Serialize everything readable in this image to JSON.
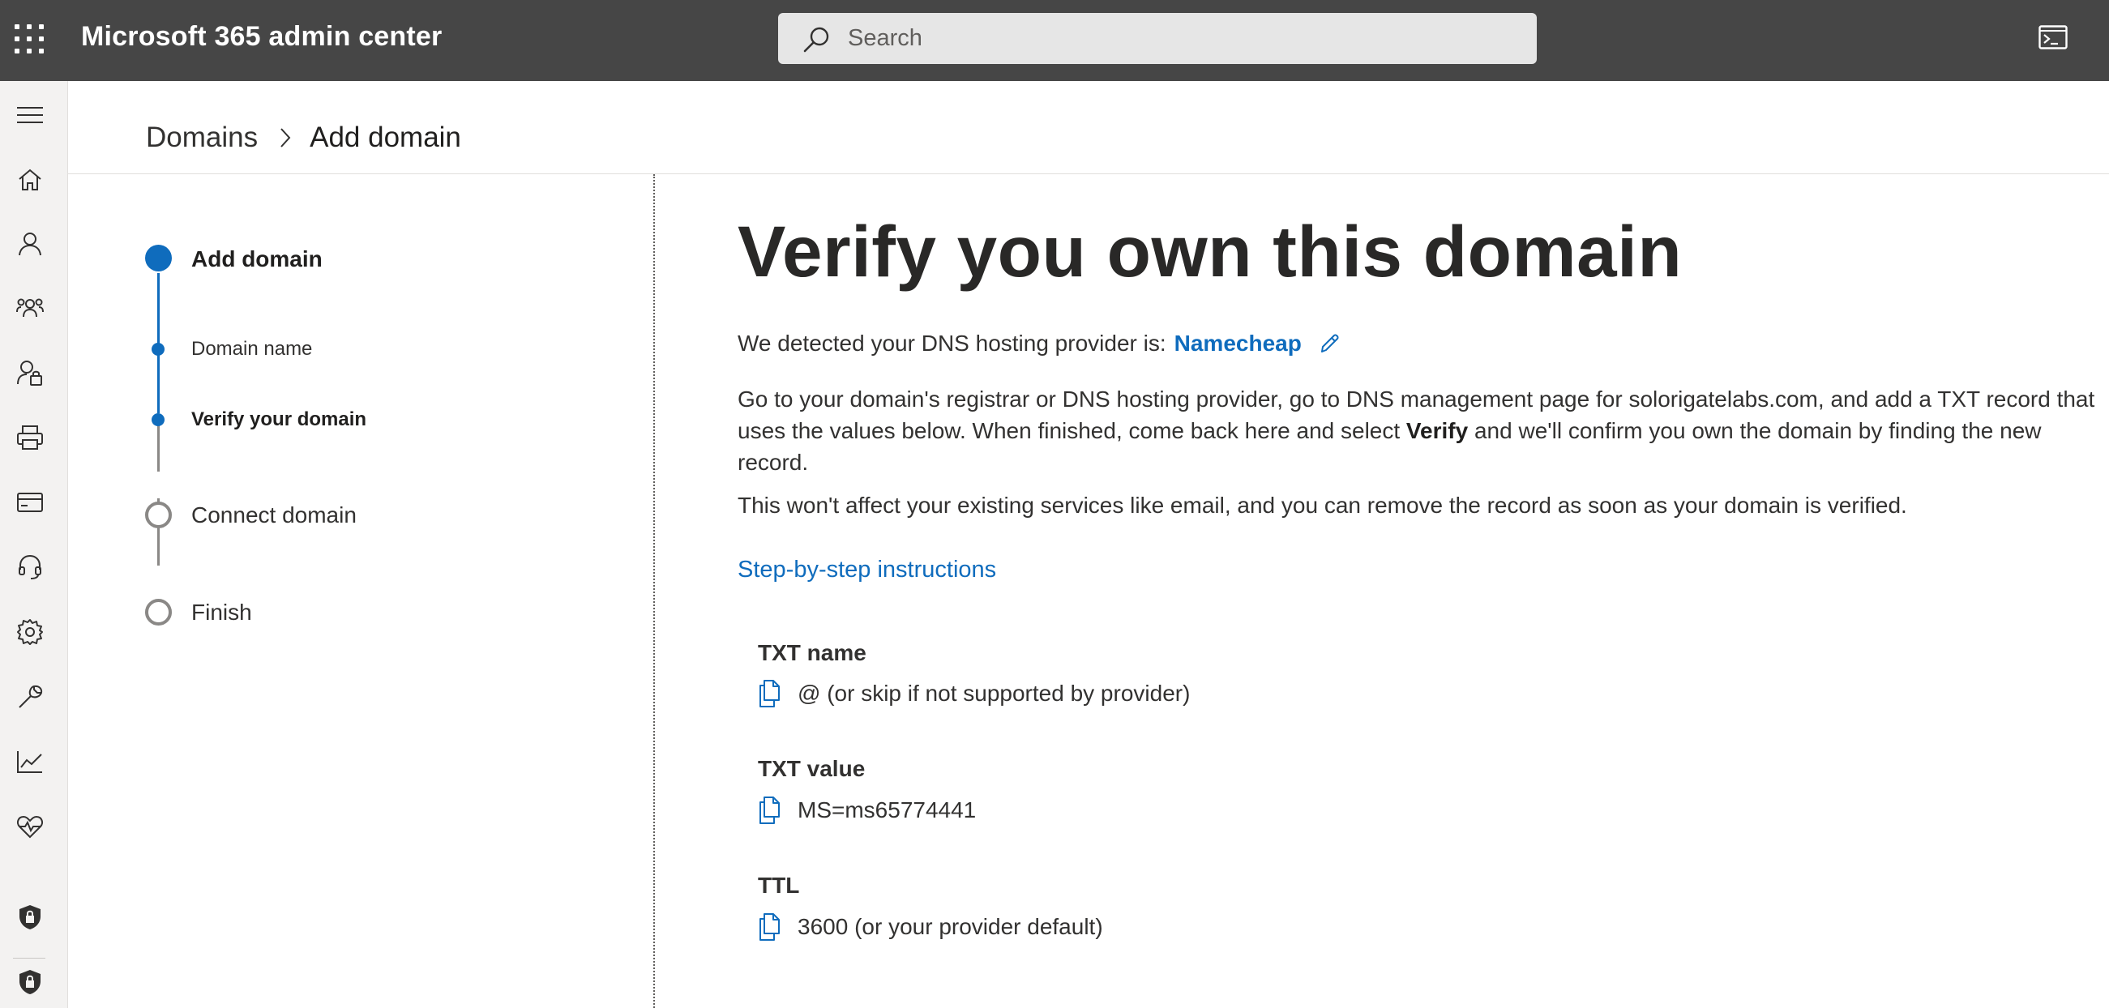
{
  "app": {
    "title": "Microsoft 365 admin center",
    "waffle_icon": "app-launcher-icon",
    "console_icon": "cloud-shell-icon"
  },
  "search": {
    "placeholder": "Search",
    "value": ""
  },
  "rail": {
    "items": [
      {
        "icon": "hamburger-menu-icon"
      },
      {
        "icon": "home-icon"
      },
      {
        "icon": "user-icon"
      },
      {
        "icon": "teams-icon"
      },
      {
        "icon": "roles-icon"
      },
      {
        "icon": "printer-icon"
      },
      {
        "icon": "billing-icon"
      },
      {
        "icon": "support-icon"
      },
      {
        "icon": "settings-icon"
      },
      {
        "icon": "setup-icon"
      },
      {
        "icon": "reports-icon"
      },
      {
        "icon": "health-icon"
      },
      {
        "icon": "security-icon"
      },
      {
        "icon": "compliance-icon"
      }
    ]
  },
  "breadcrumb": {
    "parent": "Domains",
    "current": "Add domain"
  },
  "stepper": {
    "steps": [
      {
        "label": "Add domain",
        "state": "active"
      },
      {
        "label": "Domain name",
        "state": "done-substep"
      },
      {
        "label": "Verify your domain",
        "state": "current-substep"
      },
      {
        "label": "Connect domain",
        "state": "pending"
      },
      {
        "label": "Finish",
        "state": "pending"
      }
    ],
    "active_color": "#0f6cbd"
  },
  "content": {
    "heading": "Verify you own this domain",
    "detected_prefix": "We detected your DNS hosting provider is:",
    "provider": "Namecheap",
    "instructions_a": "Go to your domain's registrar or DNS hosting provider, go to DNS management page for solorigatelabs.com, and add a TXT record that uses the values below. When finished, come back here and select ",
    "instructions_bold": "Verify",
    "instructions_b": " and we'll confirm you own the domain by finding the new record.",
    "note": "This won't affect your existing services like email, and you can remove the record as soon as your domain is verified.",
    "link": "Step-by-step instructions"
  },
  "records": [
    {
      "title": "TXT name",
      "value": "@ (or skip if not supported by provider)"
    },
    {
      "title": "TXT value",
      "value": "MS=ms65774441"
    },
    {
      "title": "TTL",
      "value": "3600 (or your provider default)"
    }
  ]
}
